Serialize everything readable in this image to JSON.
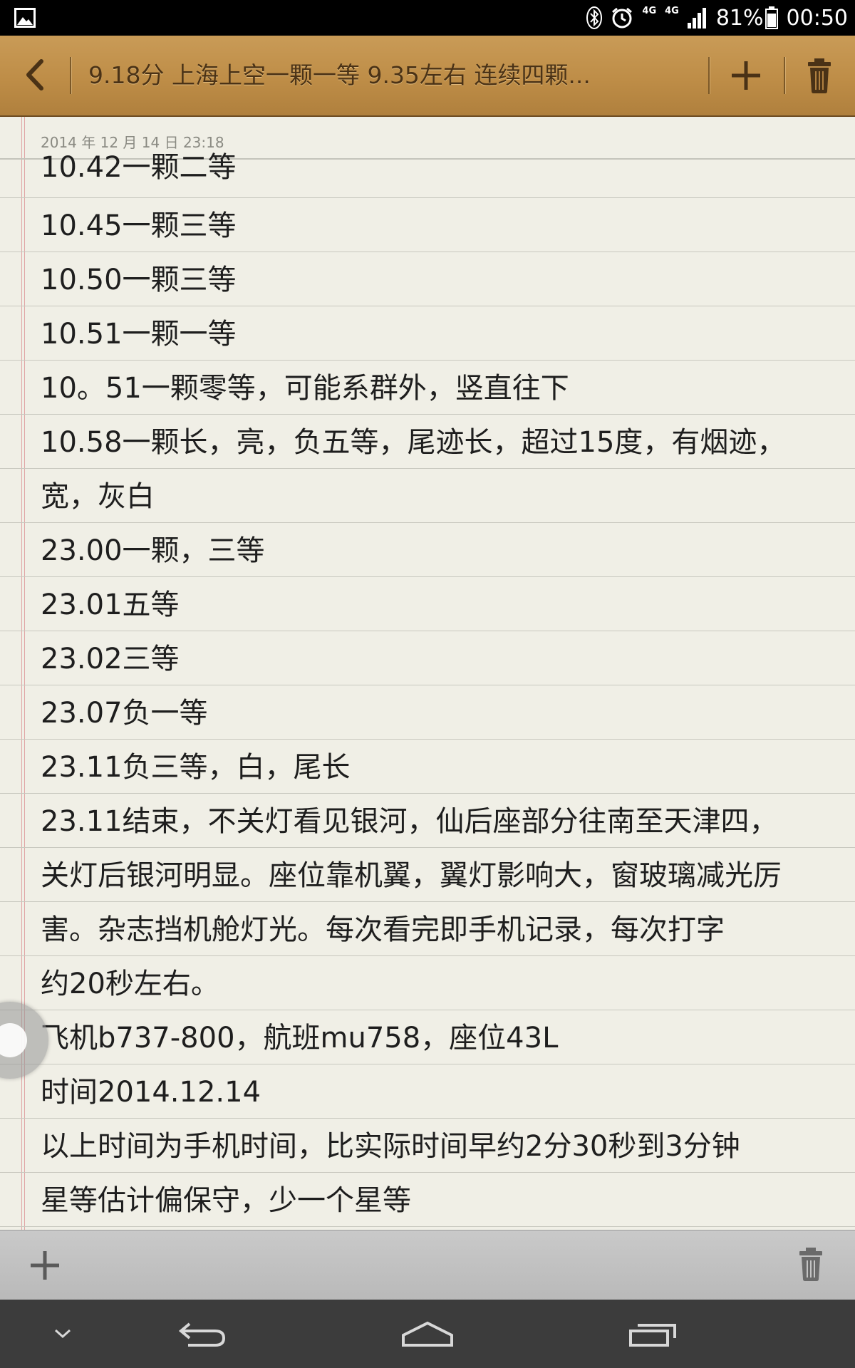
{
  "status_bar": {
    "network_1": "4G",
    "network_2": "4G",
    "battery": "81%",
    "time": "00:50"
  },
  "title_bar": {
    "title": "9.18分 上海上空一颗一等 9.35左右 连续四颗..."
  },
  "note": {
    "date": "2014 年 12 月 14 日 23:18",
    "lines": [
      "10.42一颗二等",
      "10.45一颗三等",
      "10.50一颗三等",
      "10.51一颗一等",
      "10。51一颗零等，可能系群外，竖直往下",
      "10.58一颗长，亮，负五等，尾迹长，超过15度，有烟迹，",
      "宽，灰白",
      "23.00一颗，三等",
      "23.01五等",
      "23.02三等",
      "23.07负一等",
      "23.11负三等，白，尾长",
      "23.11结束，不关灯看见银河，仙后座部分往南至天津四，",
      "关灯后银河明显。座位靠机翼，翼灯影响大，窗玻璃减光厉",
      "害。杂志挡机舱灯光。每次看完即手机记录，每次打字",
      "约20秒左右。",
      "飞机b737-800，航班mu758，座位43L",
      "时间2014.12.14",
      "以上时间为手机时间，比实际时间早约2分30秒到3分钟",
      "星等估计偏保守，少一个星等"
    ]
  },
  "icons": {
    "status_left": "gallery-icon",
    "status_bluetooth": "bluetooth-icon",
    "status_alarm": "alarm-icon",
    "status_signal": "signal-icon",
    "status_battery": "battery-icon",
    "title_back": "back-chevron-icon",
    "title_add": "plus-icon",
    "title_trash": "trash-icon",
    "bottom_add": "plus-icon",
    "bottom_trash": "trash-icon",
    "nav_down": "chevron-down-icon",
    "nav_back": "back-arrow-icon",
    "nav_home": "home-icon",
    "nav_recent": "recent-apps-icon"
  },
  "colors": {
    "title_bar": "#c08f4a",
    "paper": "#f0efe6",
    "rule_line": "#c8c8bf",
    "margin_line": "#e0a6a6",
    "nav_bar": "#3c3c3c"
  }
}
